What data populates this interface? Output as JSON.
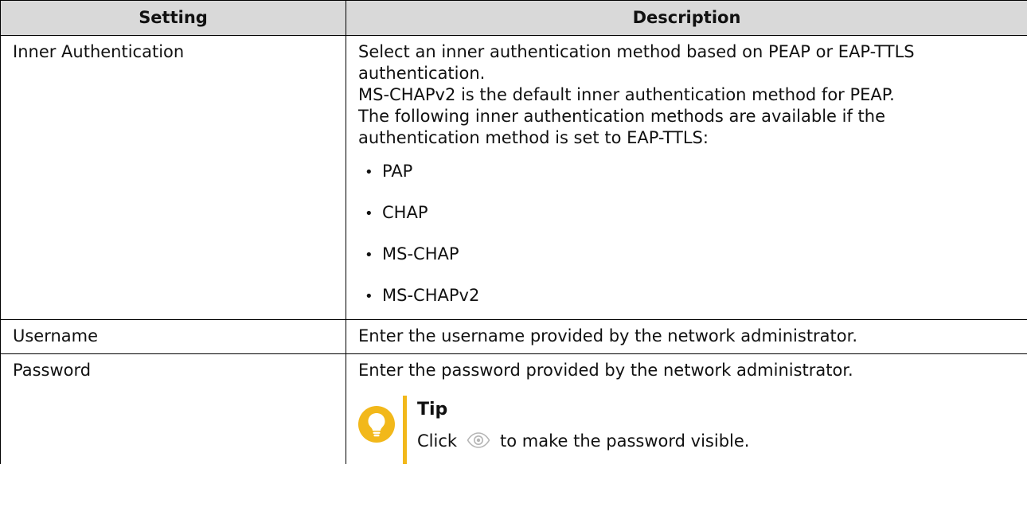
{
  "table": {
    "headers": [
      "Setting",
      "Description"
    ],
    "rows": [
      {
        "setting": "Inner Authentication",
        "description_lines": [
          "Select an inner authentication method based on PEAP or EAP-TTLS",
          "authentication.",
          "MS-CHAPv2 is the default inner authentication method for PEAP.",
          "The following inner authentication methods are available if the",
          "authentication method is set to EAP-TTLS:"
        ],
        "bullets": [
          "PAP",
          "CHAP",
          "MS-CHAP",
          "MS-CHAPv2"
        ]
      },
      {
        "setting": "Username",
        "description": "Enter the username provided by the network administrator."
      },
      {
        "setting": "Password",
        "description": "Enter the password provided by the network administrator.",
        "tip": {
          "title": "Tip",
          "text_before": "Click",
          "icon": "eye-icon",
          "text_after": "to make the password visible."
        }
      }
    ]
  },
  "colors": {
    "header_background": "#d9d9d9",
    "tip_accent": "#f2b81a",
    "icon_gray": "#b5b5b5"
  }
}
